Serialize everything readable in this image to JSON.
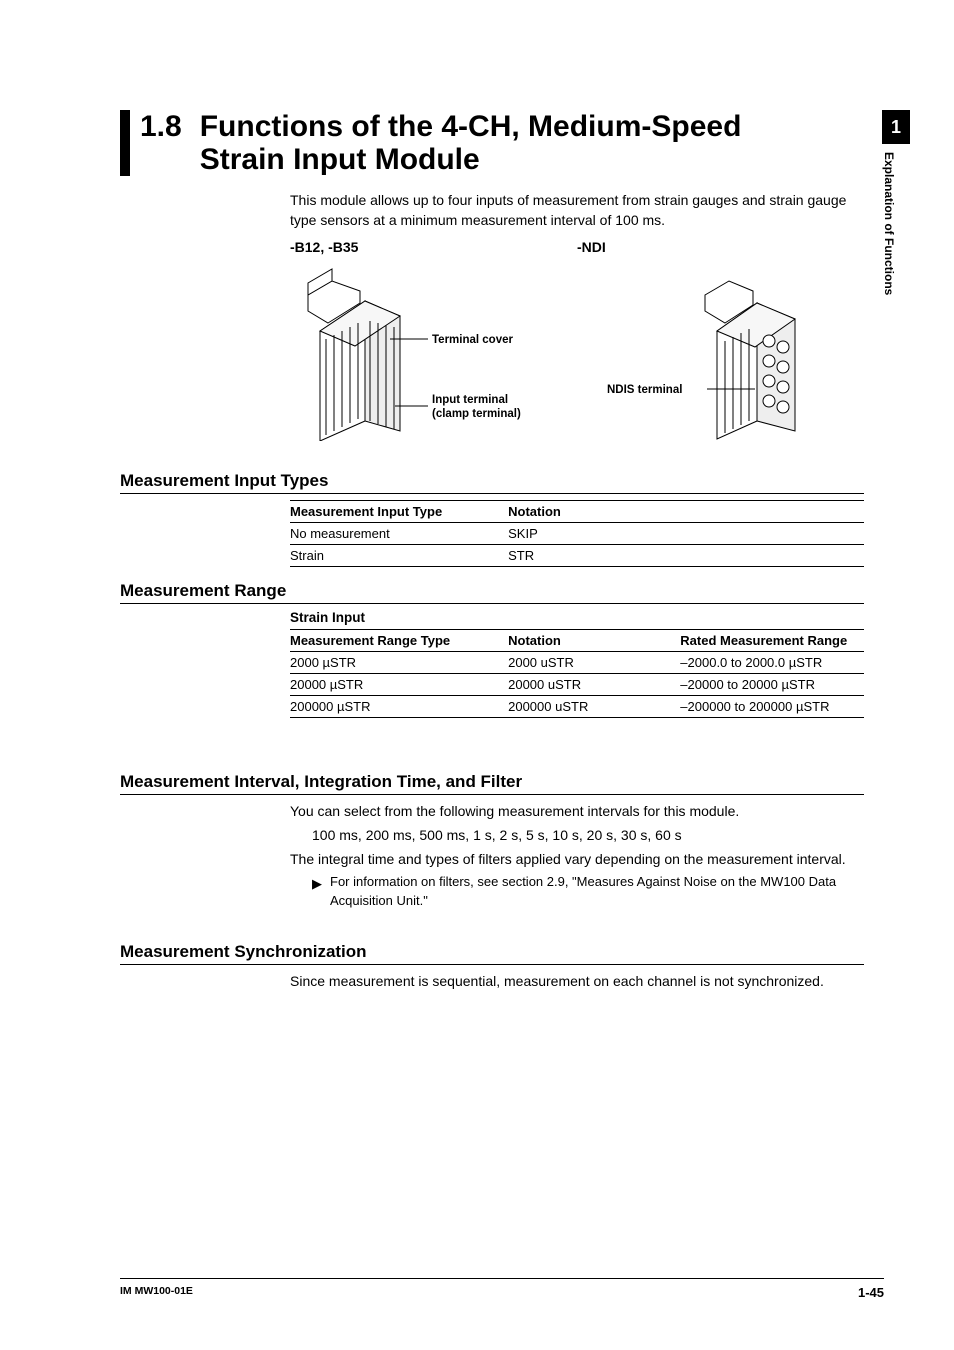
{
  "sideTab": {
    "number": "1",
    "text": "Explanation of Functions"
  },
  "header": {
    "number": "1.8",
    "title": "Functions of the 4-CH, Medium-Speed Strain Input Module"
  },
  "intro": "This module allows up to four inputs of measurement from strain gauges and strain gauge type sensors at a minimum measurement interval of 100 ms.",
  "figures": {
    "left": {
      "label": "-B12, -B35",
      "callout1": "Terminal cover",
      "callout2": "Input terminal (clamp terminal)"
    },
    "right": {
      "label": "-NDI",
      "callout1": "NDIS terminal"
    }
  },
  "sections": {
    "inputTypes": {
      "heading": "Measurement Input Types",
      "headers": [
        "Measurement Input Type",
        "Notation"
      ],
      "rows": [
        [
          "No measurement",
          "SKIP"
        ],
        [
          "Strain",
          "STR"
        ]
      ]
    },
    "range": {
      "heading": "Measurement Range",
      "subtitle": "Strain Input",
      "headers": [
        "Measurement Range Type",
        "Notation",
        "Rated Measurement Range"
      ],
      "rows": [
        [
          "2000 µSTR",
          "2000 uSTR",
          "–2000.0 to 2000.0 µSTR"
        ],
        [
          "20000 µSTR",
          "20000 uSTR",
          "–20000 to 20000 µSTR"
        ],
        [
          "200000 µSTR",
          "200000 uSTR",
          "–200000 to 200000 µSTR"
        ]
      ]
    },
    "interval": {
      "heading": "Measurement Interval, Integration Time, and Filter",
      "p1": "You can select from the following measurement intervals for this module.",
      "p2": "100 ms, 200 ms, 500 ms, 1 s, 2 s, 5 s, 10 s, 20 s, 30 s, 60 s",
      "p3": "The integral time and types of filters applied vary depending on the measurement interval.",
      "note": "For information on filters, see section 2.9, \"Measures Against Noise on the MW100 Data Acquisition Unit.\""
    },
    "sync": {
      "heading": "Measurement Synchronization",
      "p1": "Since measurement is sequential, measurement on each channel is not synchronized."
    }
  },
  "footer": {
    "left": "IM MW100-01E",
    "right": "1-45"
  }
}
